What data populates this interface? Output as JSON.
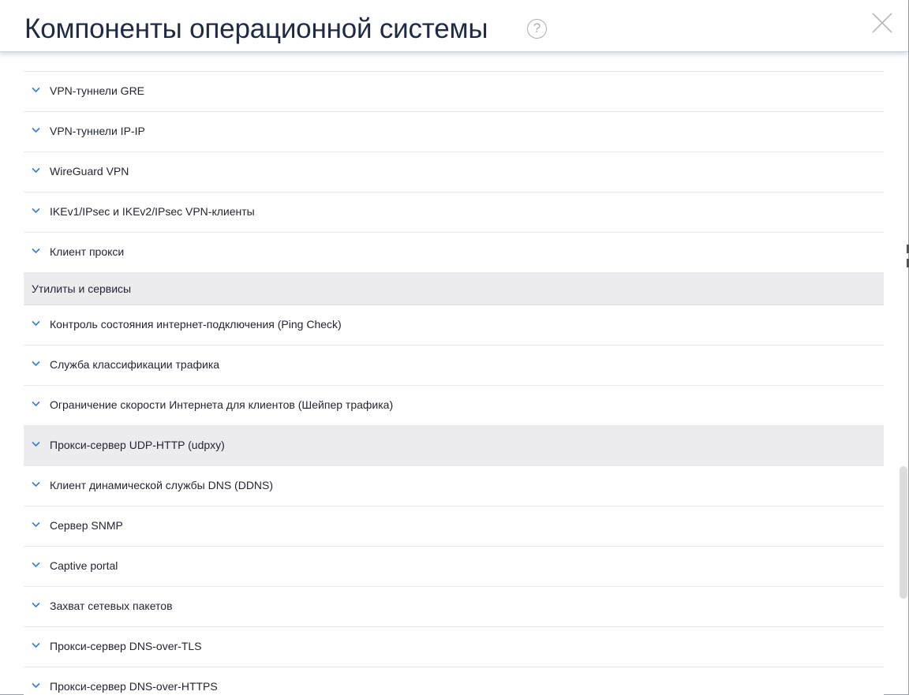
{
  "header": {
    "title": "Компоненты операционной системы",
    "help_icon": "question-circle-icon",
    "help_glyph": "?",
    "close_icon": "close-x-icon"
  },
  "list": {
    "group_vpn": [
      {
        "label": "VPN-туннели GRE"
      },
      {
        "label": "VPN-туннели IP-IP"
      },
      {
        "label": "WireGuard VPN"
      },
      {
        "label": "IKEv1/IPsec и IKEv2/IPsec VPN-клиенты"
      },
      {
        "label": "Клиент прокси"
      }
    ],
    "section_utilities": "Утилиты и сервисы",
    "group_utilities": [
      {
        "label": "Контроль состояния интернет-подключения (Ping Check)"
      },
      {
        "label": "Служба классификации трафика"
      },
      {
        "label": "Ограничение скорости Интернета для клиентов (Шейпер трафика)"
      },
      {
        "label": "Прокси-сервер UDP-HTTP (udpxy)"
      },
      {
        "label": "Клиент динамической службы DNS (DDNS)"
      },
      {
        "label": "Сервер SNMP"
      },
      {
        "label": "Captive portal"
      },
      {
        "label": "Захват сетевых пакетов"
      },
      {
        "label": "Прокси-сервер DNS-over-TLS"
      },
      {
        "label": "Прокси-сервер DNS-over-HTTPS"
      }
    ]
  },
  "colors": {
    "chevron": "#2f7fd0",
    "title": "#1f2a44",
    "row_hover": "#ececee",
    "section_bg": "#ececee"
  }
}
